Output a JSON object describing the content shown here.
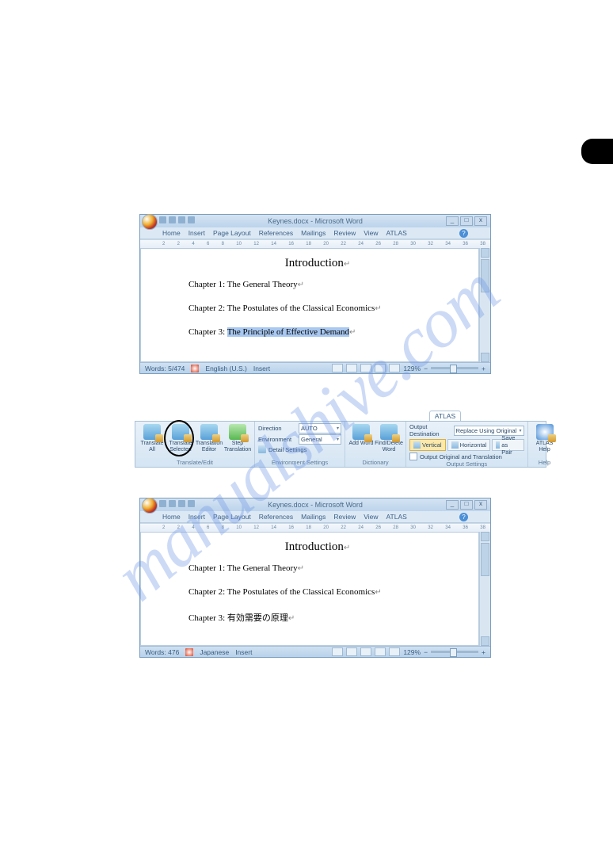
{
  "watermark": "manualshive.com",
  "window": {
    "title": "Keynes.docx - Microsoft Word",
    "controls": {
      "min": "_",
      "max": "□",
      "close": "x"
    }
  },
  "menus": {
    "home": "Home",
    "insert": "Insert",
    "pagelayout": "Page Layout",
    "references": "References",
    "mailings": "Mailings",
    "review": "Review",
    "view": "View",
    "atlas": "ATLAS"
  },
  "ruler_marks": [
    "2",
    "",
    "2",
    "4",
    "6",
    "8",
    "10",
    "12",
    "14",
    "16",
    "18",
    "20",
    "22",
    "24",
    "26",
    "28",
    "30",
    "32",
    "34",
    "36",
    "38"
  ],
  "doc1": {
    "title": "Introduction",
    "ch1": "Chapter 1: The General Theory",
    "ch2": "Chapter 2: The Postulates of the Classical Economics",
    "ch3_prefix": "Chapter 3: ",
    "ch3_sel": "The Principle of Effective Demand"
  },
  "doc2": {
    "title": "Introduction",
    "ch1": "Chapter 1: The General Theory",
    "ch2": "Chapter 2: The Postulates of the Classical Economics",
    "ch3": "Chapter 3:  有効需要の原理"
  },
  "status1": {
    "words": "Words: 5/474",
    "lang": "English (U.S.)",
    "mode": "Insert",
    "zoom": "129%"
  },
  "status2": {
    "words": "Words: 476",
    "lang": "Japanese",
    "mode": "Insert",
    "zoom": "129%"
  },
  "ribbon": {
    "tab": "ATLAS",
    "translate": {
      "all": "Translate All",
      "selected": "Translate Selected",
      "editor": "Translation Editor",
      "step": "Step Translation",
      "group": "Translate/Edit"
    },
    "env": {
      "direction_lbl": "Direction",
      "direction_val": "AUTO",
      "environment_lbl": "Environment",
      "environment_val": "General",
      "detail": "Detail Settings",
      "group": "Environment Settings"
    },
    "dict": {
      "add": "Add Word",
      "find": "Find/Delete Word",
      "group": "Dictionary"
    },
    "output": {
      "dest_lbl": "Output Destination",
      "dest_val": "Replace Using Original",
      "vertical": "Vertical",
      "horizontal": "Horizontal",
      "savepair": "Save as Pair",
      "outboth": "Output Original and Translation",
      "group": "Output Settings"
    },
    "help": {
      "btn": "ATLAS Help",
      "group": "Help"
    }
  }
}
